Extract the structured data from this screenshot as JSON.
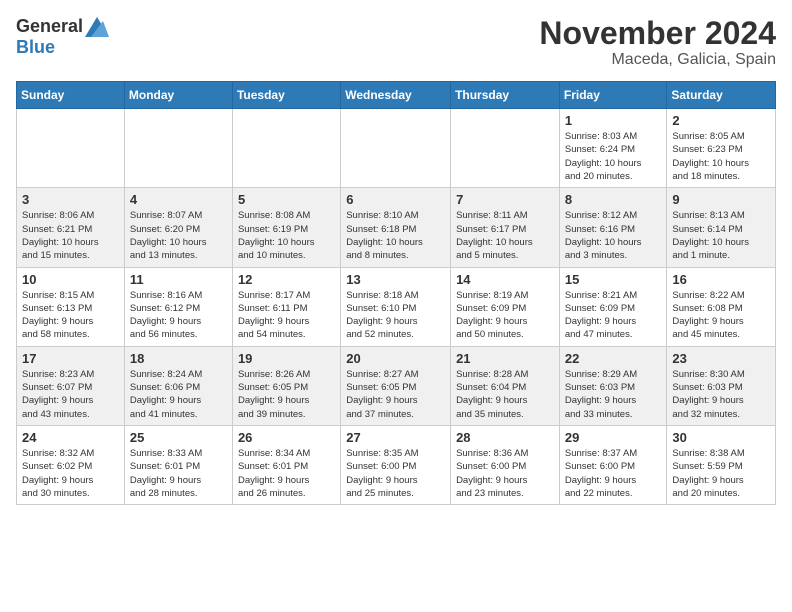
{
  "header": {
    "logo_general": "General",
    "logo_blue": "Blue",
    "month_title": "November 2024",
    "location": "Maceda, Galicia, Spain"
  },
  "days_of_week": [
    "Sunday",
    "Monday",
    "Tuesday",
    "Wednesday",
    "Thursday",
    "Friday",
    "Saturday"
  ],
  "weeks": [
    [
      {
        "day": "",
        "info": ""
      },
      {
        "day": "",
        "info": ""
      },
      {
        "day": "",
        "info": ""
      },
      {
        "day": "",
        "info": ""
      },
      {
        "day": "",
        "info": ""
      },
      {
        "day": "1",
        "info": "Sunrise: 8:03 AM\nSunset: 6:24 PM\nDaylight: 10 hours\nand 20 minutes."
      },
      {
        "day": "2",
        "info": "Sunrise: 8:05 AM\nSunset: 6:23 PM\nDaylight: 10 hours\nand 18 minutes."
      }
    ],
    [
      {
        "day": "3",
        "info": "Sunrise: 8:06 AM\nSunset: 6:21 PM\nDaylight: 10 hours\nand 15 minutes."
      },
      {
        "day": "4",
        "info": "Sunrise: 8:07 AM\nSunset: 6:20 PM\nDaylight: 10 hours\nand 13 minutes."
      },
      {
        "day": "5",
        "info": "Sunrise: 8:08 AM\nSunset: 6:19 PM\nDaylight: 10 hours\nand 10 minutes."
      },
      {
        "day": "6",
        "info": "Sunrise: 8:10 AM\nSunset: 6:18 PM\nDaylight: 10 hours\nand 8 minutes."
      },
      {
        "day": "7",
        "info": "Sunrise: 8:11 AM\nSunset: 6:17 PM\nDaylight: 10 hours\nand 5 minutes."
      },
      {
        "day": "8",
        "info": "Sunrise: 8:12 AM\nSunset: 6:16 PM\nDaylight: 10 hours\nand 3 minutes."
      },
      {
        "day": "9",
        "info": "Sunrise: 8:13 AM\nSunset: 6:14 PM\nDaylight: 10 hours\nand 1 minute."
      }
    ],
    [
      {
        "day": "10",
        "info": "Sunrise: 8:15 AM\nSunset: 6:13 PM\nDaylight: 9 hours\nand 58 minutes."
      },
      {
        "day": "11",
        "info": "Sunrise: 8:16 AM\nSunset: 6:12 PM\nDaylight: 9 hours\nand 56 minutes."
      },
      {
        "day": "12",
        "info": "Sunrise: 8:17 AM\nSunset: 6:11 PM\nDaylight: 9 hours\nand 54 minutes."
      },
      {
        "day": "13",
        "info": "Sunrise: 8:18 AM\nSunset: 6:10 PM\nDaylight: 9 hours\nand 52 minutes."
      },
      {
        "day": "14",
        "info": "Sunrise: 8:19 AM\nSunset: 6:09 PM\nDaylight: 9 hours\nand 50 minutes."
      },
      {
        "day": "15",
        "info": "Sunrise: 8:21 AM\nSunset: 6:09 PM\nDaylight: 9 hours\nand 47 minutes."
      },
      {
        "day": "16",
        "info": "Sunrise: 8:22 AM\nSunset: 6:08 PM\nDaylight: 9 hours\nand 45 minutes."
      }
    ],
    [
      {
        "day": "17",
        "info": "Sunrise: 8:23 AM\nSunset: 6:07 PM\nDaylight: 9 hours\nand 43 minutes."
      },
      {
        "day": "18",
        "info": "Sunrise: 8:24 AM\nSunset: 6:06 PM\nDaylight: 9 hours\nand 41 minutes."
      },
      {
        "day": "19",
        "info": "Sunrise: 8:26 AM\nSunset: 6:05 PM\nDaylight: 9 hours\nand 39 minutes."
      },
      {
        "day": "20",
        "info": "Sunrise: 8:27 AM\nSunset: 6:05 PM\nDaylight: 9 hours\nand 37 minutes."
      },
      {
        "day": "21",
        "info": "Sunrise: 8:28 AM\nSunset: 6:04 PM\nDaylight: 9 hours\nand 35 minutes."
      },
      {
        "day": "22",
        "info": "Sunrise: 8:29 AM\nSunset: 6:03 PM\nDaylight: 9 hours\nand 33 minutes."
      },
      {
        "day": "23",
        "info": "Sunrise: 8:30 AM\nSunset: 6:03 PM\nDaylight: 9 hours\nand 32 minutes."
      }
    ],
    [
      {
        "day": "24",
        "info": "Sunrise: 8:32 AM\nSunset: 6:02 PM\nDaylight: 9 hours\nand 30 minutes."
      },
      {
        "day": "25",
        "info": "Sunrise: 8:33 AM\nSunset: 6:01 PM\nDaylight: 9 hours\nand 28 minutes."
      },
      {
        "day": "26",
        "info": "Sunrise: 8:34 AM\nSunset: 6:01 PM\nDaylight: 9 hours\nand 26 minutes."
      },
      {
        "day": "27",
        "info": "Sunrise: 8:35 AM\nSunset: 6:00 PM\nDaylight: 9 hours\nand 25 minutes."
      },
      {
        "day": "28",
        "info": "Sunrise: 8:36 AM\nSunset: 6:00 PM\nDaylight: 9 hours\nand 23 minutes."
      },
      {
        "day": "29",
        "info": "Sunrise: 8:37 AM\nSunset: 6:00 PM\nDaylight: 9 hours\nand 22 minutes."
      },
      {
        "day": "30",
        "info": "Sunrise: 8:38 AM\nSunset: 5:59 PM\nDaylight: 9 hours\nand 20 minutes."
      }
    ]
  ]
}
